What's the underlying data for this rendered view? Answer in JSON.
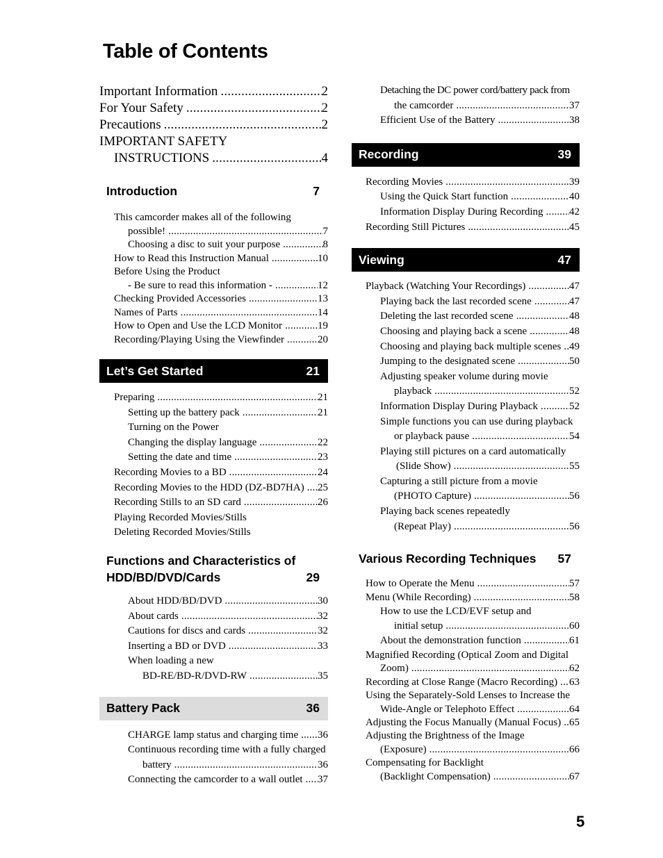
{
  "title": "Table of Contents",
  "page_number": "5",
  "left": {
    "top_entries": [
      {
        "label": "Important Information",
        "page": "2"
      },
      {
        "label": "For Your Safety",
        "page": "2"
      },
      {
        "label": "Precautions",
        "page": "2"
      },
      {
        "label": "IMPORTANT SAFETY",
        "page": ""
      },
      {
        "label": "INSTRUCTIONS",
        "page": "4"
      }
    ],
    "introduction": {
      "title": "Introduction",
      "page": "7",
      "entries": [
        {
          "label": "This camcorder makes all of the following",
          "page": ""
        },
        {
          "label": "possible!",
          "page": "7"
        },
        {
          "label": "Choosing a disc to suit your purpose",
          "page": "8"
        },
        {
          "label": "How to Read this Instruction Manual",
          "page": "10"
        },
        {
          "label": "Before Using the Product",
          "page": ""
        },
        {
          "label": "- Be sure to read this information -",
          "page": "12"
        },
        {
          "label": "Checking Provided Accessories",
          "page": "13"
        },
        {
          "label": "Names of Parts",
          "page": "14"
        },
        {
          "label": "How to Open and Use the LCD Monitor",
          "page": "19"
        },
        {
          "label": "Recording/Playing Using the Viewfinder",
          "page": "20"
        }
      ]
    },
    "lets_get_started": {
      "title": "Let’s Get Started",
      "page": "21",
      "entries": [
        {
          "label": "Preparing",
          "page": "21"
        },
        {
          "label": "Setting up the battery pack",
          "page": "21"
        },
        {
          "label": "Turning on the Power",
          "page": ""
        },
        {
          "label": "Changing the display language",
          "page": "22"
        },
        {
          "label": "Setting the date and time",
          "page": "23"
        },
        {
          "label": "Recording Movies to a BD",
          "page": "24"
        },
        {
          "label": "Recording Movies to the HDD (DZ-BD7HA)",
          "page": "25"
        },
        {
          "label": "Recording Stills to an SD card",
          "page": "26"
        },
        {
          "label": "Playing Recorded Movies/Stills",
          "page": ""
        },
        {
          "label": "Deleting Recorded Movies/Stills",
          "page": ""
        }
      ]
    },
    "functions": {
      "title_line1": "Functions and Characteristics of",
      "title_line2": "HDD/BD/DVD/Cards",
      "page": "29",
      "entries": [
        {
          "label": "About HDD/BD/DVD",
          "page": "30"
        },
        {
          "label": "About cards",
          "page": "32"
        },
        {
          "label": "Cautions for discs and cards",
          "page": "32"
        },
        {
          "label": "Inserting a BD or DVD",
          "page": "33"
        },
        {
          "label": "When loading a new",
          "page": ""
        },
        {
          "label": "BD-RE/BD-R/DVD-RW",
          "page": "35"
        }
      ]
    },
    "battery_pack": {
      "title": "Battery Pack",
      "page": "36",
      "entries": [
        {
          "label": "CHARGE lamp status and charging time",
          "page": "36"
        },
        {
          "label": "Continuous recording time with a fully charged",
          "page": ""
        },
        {
          "label": "battery",
          "page": "36"
        },
        {
          "label": "Connecting the camcorder to a wall outlet",
          "page": "37"
        }
      ]
    }
  },
  "right": {
    "battery_cont": [
      {
        "label": "Detaching the DC power cord/battery pack from",
        "page": ""
      },
      {
        "label": "the camcorder",
        "page": "37"
      },
      {
        "label": "Efficient Use of the Battery",
        "page": "38"
      }
    ],
    "recording": {
      "title": "Recording",
      "page": "39",
      "entries": [
        {
          "label": "Recording Movies",
          "page": "39"
        },
        {
          "label": "Using the Quick Start function",
          "page": "40"
        },
        {
          "label": "Information Display During Recording",
          "page": "42"
        },
        {
          "label": "Recording Still Pictures",
          "page": "45"
        }
      ]
    },
    "viewing": {
      "title": "Viewing",
      "page": "47",
      "entries": [
        {
          "label": "Playback (Watching Your Recordings)",
          "page": "47"
        },
        {
          "label": "Playing back the last recorded scene",
          "page": "47"
        },
        {
          "label": "Deleting the last recorded scene",
          "page": "48"
        },
        {
          "label": "Choosing and playing back a scene",
          "page": "48"
        },
        {
          "label": "Choosing and playing back multiple scenes",
          "page": "49"
        },
        {
          "label": "Jumping to the designated scene",
          "page": "50"
        },
        {
          "label": "Adjusting speaker volume during movie",
          "page": ""
        },
        {
          "label": "playback",
          "page": "52"
        },
        {
          "label": "Information Display During Playback",
          "page": "52"
        },
        {
          "label": "Simple functions you can use during playback",
          "page": ""
        },
        {
          "label": "or playback pause",
          "page": "54"
        },
        {
          "label": "Playing still pictures on a card automatically",
          "page": ""
        },
        {
          "label": "(Slide Show)",
          "page": "55"
        },
        {
          "label": "Capturing a still picture from a movie",
          "page": ""
        },
        {
          "label": "(PHOTO Capture)",
          "page": "56"
        },
        {
          "label": "Playing back scenes repeatedly",
          "page": ""
        },
        {
          "label": "(Repeat Play)",
          "page": "56"
        }
      ]
    },
    "various": {
      "title": "Various Recording Techniques",
      "page": "57",
      "entries": [
        {
          "label": "How to Operate the Menu",
          "page": "57"
        },
        {
          "label": "Menu (While Recording)",
          "page": "58"
        },
        {
          "label": "How to use the LCD/EVF setup and",
          "page": ""
        },
        {
          "label": "initial setup",
          "page": "60"
        },
        {
          "label": "About the demonstration function",
          "page": "61"
        },
        {
          "label": "Magnified Recording (Optical Zoom and Digital",
          "page": ""
        },
        {
          "label": "Zoom)",
          "page": "62"
        },
        {
          "label": "Recording at Close Range (Macro Recording)",
          "page": "63"
        },
        {
          "label": "Using the Separately-Sold Lenses to Increase the",
          "page": ""
        },
        {
          "label": "Wide-Angle or Telephoto Effect",
          "page": "64"
        },
        {
          "label": "Adjusting the Focus Manually (Manual Focus)",
          "page": "65"
        },
        {
          "label": "Adjusting the Brightness of the Image",
          "page": ""
        },
        {
          "label": "(Exposure)",
          "page": "66"
        },
        {
          "label": "Compensating for Backlight",
          "page": ""
        },
        {
          "label": "(Backlight Compensation)",
          "page": "67"
        }
      ]
    }
  }
}
